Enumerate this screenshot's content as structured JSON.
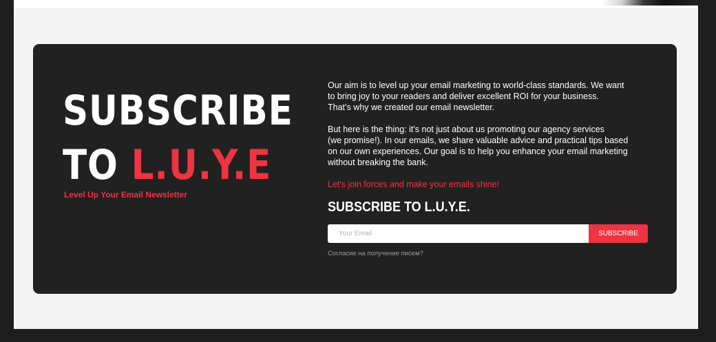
{
  "hero": {
    "title_line1": "SUBSCRIBE",
    "title_line2_prefix": "TO ",
    "title_line2_accent": "L.U.Y.E",
    "subtitle": "Level Up Your Email Newsletter"
  },
  "content": {
    "paragraph1_line1": "Our aim is to level up your email marketing to world-class standards. We want",
    "paragraph1_line2": "to bring joy to your readers and deliver excellent ROI for your business.",
    "paragraph1_line3": "That’s why we created our email newsletter.",
    "paragraph2_line1": "But here is the thing: it's not just about us promoting our agency services",
    "paragraph2_line2": "(we promise!). In our emails, we share valuable advice and practical tips based",
    "paragraph2_line3": "on our own experiences. Our goal is to help you enhance your email marketing",
    "paragraph2_line4": "without breaking the bank.",
    "cta": "Let's join forces and make your emails shine!"
  },
  "form": {
    "heading": "SUBSCRIBE TO L.U.Y.E.",
    "email_placeholder": "Your Email",
    "email_value": "",
    "button_label": "SUBSCRIBE",
    "consent_link": "Согласие на получение писем?"
  },
  "colors": {
    "accent": "#ef3340",
    "card_background": "#212121",
    "page_background": "#f4f4f4",
    "outer_background": "#1e1e1e"
  }
}
